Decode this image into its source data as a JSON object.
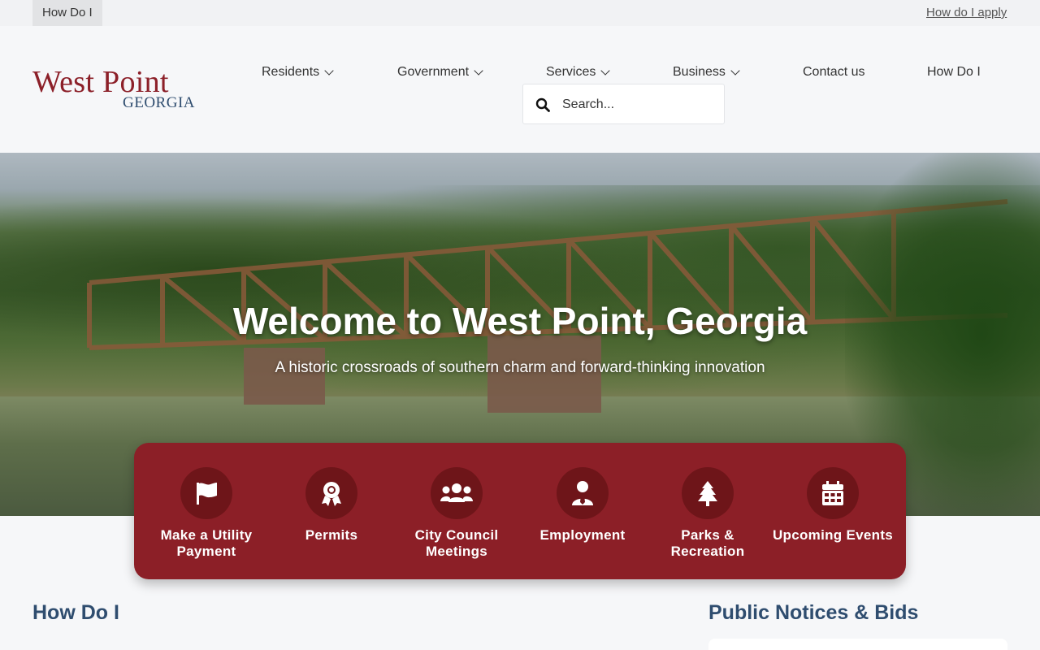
{
  "topbar": {
    "tab_label": "How Do I",
    "ticker_text": "How do I apply"
  },
  "logo": {
    "line1": "West Point",
    "line2": "GEORGIA"
  },
  "nav": {
    "items": [
      {
        "label": "Residents",
        "dropdown": true
      },
      {
        "label": "Government",
        "dropdown": true
      },
      {
        "label": "Services",
        "dropdown": true
      },
      {
        "label": "Business",
        "dropdown": true
      },
      {
        "label": "Contact us",
        "dropdown": false
      },
      {
        "label": "How Do I",
        "dropdown": false
      }
    ]
  },
  "search": {
    "placeholder": "Search..."
  },
  "hero": {
    "title": "Welcome to West Point, Georgia",
    "subtitle": "A historic crossroads of southern charm and forward-thinking innovation"
  },
  "quick_links": [
    {
      "label": "Make a Utility Payment",
      "icon": "flag-icon"
    },
    {
      "label": "Permits",
      "icon": "award-icon"
    },
    {
      "label": "City Council Meetings",
      "icon": "users-icon"
    },
    {
      "label": "Employment",
      "icon": "user-tie-icon"
    },
    {
      "label": "Parks & Recreation",
      "icon": "tree-icon"
    },
    {
      "label": "Upcoming Events",
      "icon": "calendar-icon"
    }
  ],
  "sections": {
    "how_do_i": "How Do I",
    "public_notices": "Public Notices & Bids"
  },
  "colors": {
    "brand_red": "#8c1f27",
    "brand_dark_red": "#6e1519",
    "brand_blue": "#2f4d6f"
  }
}
